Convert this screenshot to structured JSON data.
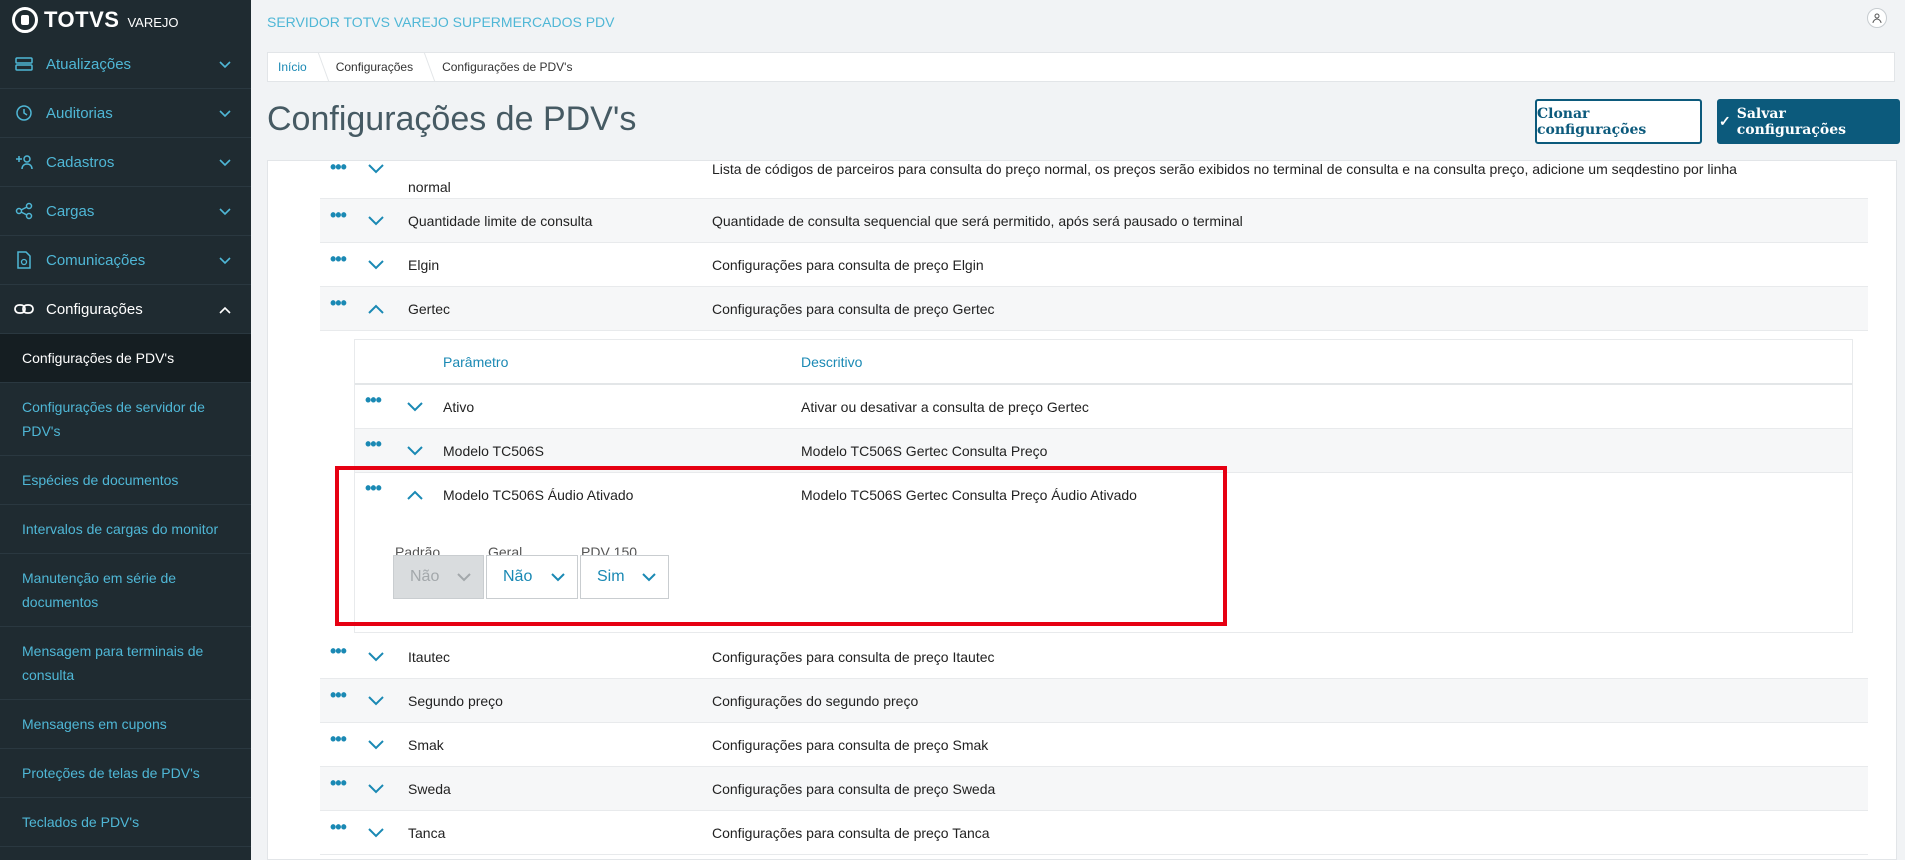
{
  "brand": {
    "name": "TOTVS",
    "sub": "VAREJO"
  },
  "server_title": "SERVIDOR TOTVS VAREJO SUPERMERCADOS PDV",
  "sidebar": {
    "items": [
      {
        "label": "Atualizações",
        "icon": "server-icon"
      },
      {
        "label": "Auditorias",
        "icon": "history-icon"
      },
      {
        "label": "Cadastros",
        "icon": "add-user-icon"
      },
      {
        "label": "Cargas",
        "icon": "share-icon"
      },
      {
        "label": "Comunicações",
        "icon": "document-icon"
      },
      {
        "label": "Configurações",
        "icon": "link-icon"
      }
    ],
    "subitems": [
      "Configurações de PDV's",
      "Configurações de servidor de PDV's",
      "Espécies de documentos",
      "Intervalos de cargas do monitor",
      "Manutenção em série de documentos",
      "Mensagem para terminais de consulta",
      "Mensagens em cupons",
      "Proteções de telas de PDV's",
      "Teclados de PDV's"
    ]
  },
  "breadcrumb": [
    "Início",
    "Configurações",
    "Configurações de PDV's"
  ],
  "page_title": "Configurações de PDV's",
  "buttons": {
    "clone": "Clonar configurações",
    "save": "Salvar configurações"
  },
  "rows_top": [
    {
      "name": "normal",
      "desc": "Lista de códigos de parceiros para consulta do preço normal, os preços serão exibidos no terminal de consulta e na consulta preço, adicione um seqdestino por linha"
    },
    {
      "name": "Quantidade limite de consulta",
      "desc": "Quantidade de consulta sequencial que será permitido, após será pausado o terminal"
    },
    {
      "name": "Elgin",
      "desc": "Configurações para consulta de preço Elgin"
    },
    {
      "name": "Gertec",
      "desc": "Configurações para consulta de preço Gertec"
    }
  ],
  "inner": {
    "col_param": "Parâmetro",
    "col_desc": "Descritivo",
    "rows": [
      {
        "name": "Ativo",
        "desc": "Ativar ou desativar a consulta de preço Gertec"
      },
      {
        "name": "Modelo TC506S",
        "desc": "Modelo TC506S Gertec Consulta Preço"
      },
      {
        "name": "Modelo TC506S Áudio Ativado",
        "desc": "Modelo TC506S Gertec Consulta Preço Áudio Ativado"
      }
    ],
    "config": {
      "labels": [
        "Padrão",
        "Geral",
        "PDV 150"
      ],
      "values": [
        "Não",
        "Não",
        "Sim"
      ]
    }
  },
  "rows_bottom": [
    {
      "name": "Itautec",
      "desc": "Configurações para consulta de preço Itautec"
    },
    {
      "name": "Segundo preço",
      "desc": "Configurações do segundo preço"
    },
    {
      "name": "Smak",
      "desc": "Configurações para consulta de preço Smak"
    },
    {
      "name": "Sweda",
      "desc": "Configurações para consulta de preço Sweda"
    },
    {
      "name": "Tanca",
      "desc": "Configurações para consulta de preço Tanca"
    }
  ],
  "colors": {
    "sidebar": "#1f2b31",
    "accent": "#1a89b4",
    "primary": "#0c5a7c",
    "highlight": "#e60012"
  }
}
